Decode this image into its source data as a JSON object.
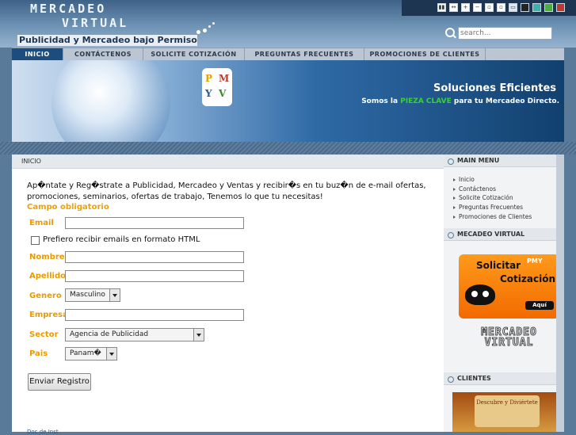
{
  "header": {
    "logo_line1": "MERCADEO",
    "logo_line2": "VIRTUAL",
    "tagline": "Publicidad y Mercadeo bajo Permiso",
    "search_placeholder": "search..."
  },
  "toolbar_icons": [
    "layout-icon",
    "width-icon",
    "zoom-in-icon",
    "zoom-out-icon",
    "reset-icon",
    "close-icon",
    "monitor-icon",
    "swatch-black-icon",
    "swatch-teal-icon",
    "swatch-green-icon",
    "swatch-red-icon"
  ],
  "nav": [
    {
      "label": "INICIO",
      "active": true
    },
    {
      "label": "CONTÁCTENOS",
      "active": false
    },
    {
      "label": "SOLICITE COTIZACIÓN",
      "active": false
    },
    {
      "label": "PREGUNTAS FRECUENTES",
      "active": false
    },
    {
      "label": "PROMOCIONES DE CLIENTES",
      "active": false
    }
  ],
  "banner": {
    "puzzle_letters": [
      "P",
      "M",
      "Y",
      "V"
    ],
    "title": "Soluciones Eficientes",
    "sub_prefix": "Somos la ",
    "sub_highlight": "PIEZA CLAVE",
    "sub_suffix": " para tu Mercadeo Directo."
  },
  "main": {
    "breadcrumb": "INICIO",
    "intro": "Ap�ntate y Reg�strate a Publicidad, Mercadeo y Ventas y recibir�s en tu buz�n de e-mail ofertas, promociones, seminarios, ofertas de trabajo, Tenemos lo que tu necesitas!",
    "required_note": "Campo obligatorio",
    "form": {
      "email_label": "Email",
      "html_pref_label": "Prefiero recibir emails en formato HTML",
      "nombre_label": "Nombre",
      "apellido_label": "Apellido",
      "genero_label": "Genero",
      "genero_value": "Masculino",
      "empresa_label": "Empresa",
      "sector_label": "Sector",
      "sector_value": "Agencia de Publicidad",
      "pais_label": "Pais",
      "pais_value": "Panam�",
      "submit_label": "Enviar Registro"
    },
    "footer_link": "Doc de Inst"
  },
  "sidebar": {
    "main_menu_title": "MAIN MENU",
    "menu_items": [
      "Inicio",
      "Contáctenos",
      "Solicite Cotización",
      "Preguntas Frecuentes",
      "Promociones de Clientes"
    ],
    "mv_title": "MECADEO VIRTUAL",
    "promo_line1": "Solicitar",
    "promo_line2": "Cotización",
    "promo_pm": "PMY",
    "promo_button": "Aquí",
    "mv_logo_line1": "MERCADEO",
    "mv_logo_line2": "VIRTUAL",
    "clientes_title": "CLIENTES",
    "client_banner": "Descubre y Diviértete"
  }
}
